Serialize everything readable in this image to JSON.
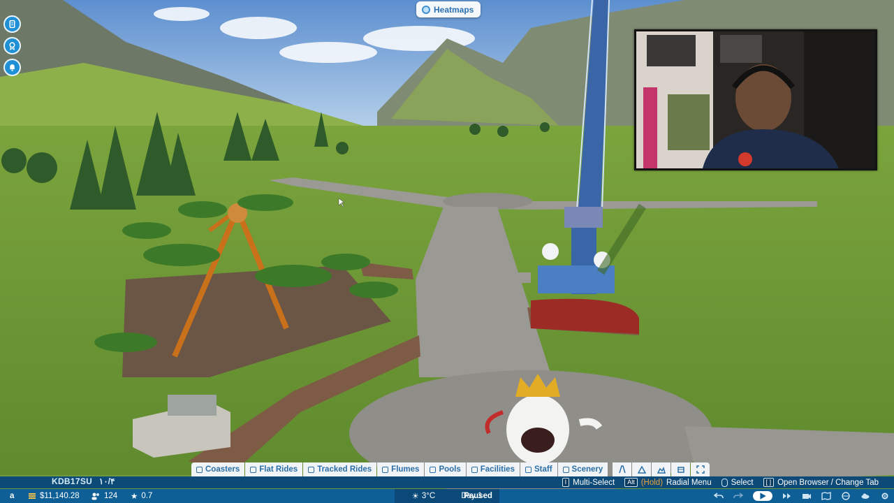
{
  "top": {
    "heatmaps_label": "Heatmaps"
  },
  "left_icons": [
    "objectives-icon",
    "award-icon",
    "notification-bell-icon"
  ],
  "build_bar": {
    "tabs": [
      {
        "label": "Coasters",
        "icon": "coaster-icon"
      },
      {
        "label": "Flat Rides",
        "icon": "flat-ride-icon"
      },
      {
        "label": "Tracked Rides",
        "icon": "tracked-ride-icon"
      },
      {
        "label": "Flumes",
        "icon": "flume-icon"
      },
      {
        "label": "Pools",
        "icon": "pool-icon"
      },
      {
        "label": "Facilities",
        "icon": "facility-icon"
      },
      {
        "label": "Staff",
        "icon": "staff-icon"
      },
      {
        "label": "Scenery",
        "icon": "scenery-icon"
      }
    ],
    "tools": [
      "path-tool-icon",
      "terrain-tool-icon",
      "landscape-tool-icon",
      "blueprint-tool-icon",
      "fullscreen-icon"
    ]
  },
  "watermark": "KDB17SU",
  "watermark_extra": "۱۰/۴",
  "hints": {
    "multiselect_label": "Multi-Select",
    "alt_key": "Alt",
    "hold_label": "(Hold)",
    "radial_menu_label": "Radial Menu",
    "select_label": "Select",
    "browser_label": "Open Browser / Change Tab"
  },
  "status": {
    "player_initial": "a",
    "money": "$11,140.28",
    "guests": "124",
    "rating": "0.7",
    "temperature": "3°C",
    "day": "Day 1",
    "state": "Paused"
  },
  "colors": {
    "ui_blue": "#0f5f97",
    "tab_text": "#2b6ea7",
    "hold_orange": "#e8a43a"
  }
}
